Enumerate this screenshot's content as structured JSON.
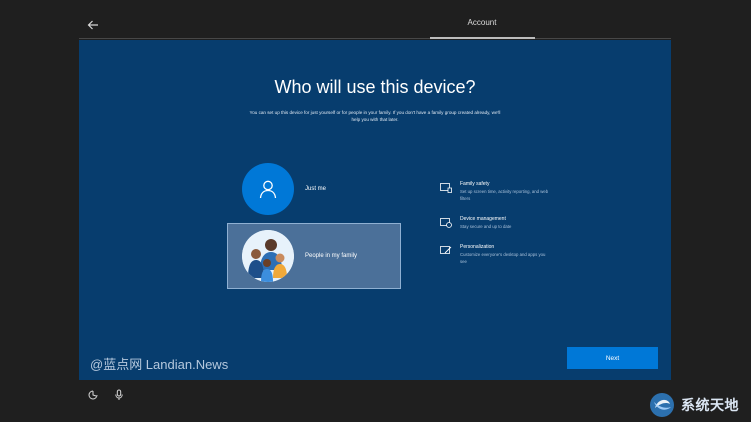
{
  "header": {
    "title": "Account",
    "back_icon": "arrow-left-icon"
  },
  "main": {
    "heading": "Who will use this device?",
    "subtext": "You can set up this device for just yourself or for people in your family. If you don't have a family group created already, we'll help you with that later.",
    "options": [
      {
        "label": "Just me",
        "icon": "person-icon"
      },
      {
        "label": "People in my family",
        "icon": "family-illustration"
      }
    ],
    "features": [
      {
        "title": "Family safety",
        "description": "Set up screen time, activity reporting, and web filters",
        "icon": "family-safety-icon"
      },
      {
        "title": "Device management",
        "description": "Stay secure and up to date",
        "icon": "device-management-icon"
      },
      {
        "title": "Personalization",
        "description": "Customize everyone's desktop and apps you see",
        "icon": "personalization-icon"
      }
    ],
    "next_label": "Next"
  },
  "watermarks": {
    "left": "@蓝点网 Landian.News",
    "right": "系统天地"
  },
  "bottom_bar": {
    "icons": [
      "accessibility-icon",
      "microphone-icon"
    ]
  },
  "colors": {
    "panel_bg": "#073d6e",
    "accent": "#0078d7",
    "selected_bg": "#4b7099",
    "frame_bg": "#1f1f1f"
  }
}
